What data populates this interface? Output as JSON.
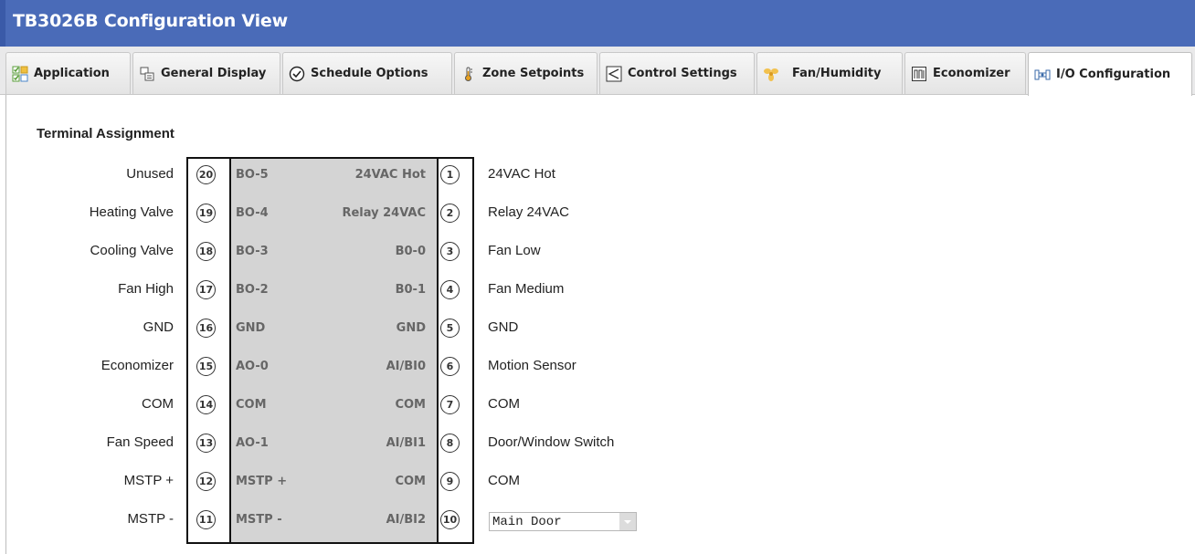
{
  "window": {
    "title": "TB3026B Configuration View"
  },
  "tabs": [
    {
      "label": "Application",
      "icon": "app-blocks-icon"
    },
    {
      "label": "General Display",
      "icon": "display-icon"
    },
    {
      "label": "Schedule Options",
      "icon": "clock-check-icon"
    },
    {
      "label": "Zone Setpoints",
      "icon": "thermometer-icon"
    },
    {
      "label": "Control Settings",
      "icon": "control-triangle-icon"
    },
    {
      "label": "Fan/Humidity",
      "icon": "fan-icon"
    },
    {
      "label": "Economizer",
      "icon": "economizer-icon"
    },
    {
      "label": "I/O Configuration",
      "icon": "io-config-icon",
      "active": true
    }
  ],
  "terminal": {
    "section_title": "Terminal Assignment",
    "rows": [
      {
        "left_label": "Unused",
        "left_pin": "20",
        "left_io": "BO-5",
        "right_io": "24VAC Hot",
        "right_pin": "1",
        "right_label": "24VAC Hot"
      },
      {
        "left_label": "Heating Valve",
        "left_pin": "19",
        "left_io": "BO-4",
        "right_io": "Relay 24VAC",
        "right_pin": "2",
        "right_label": "Relay 24VAC"
      },
      {
        "left_label": "Cooling Valve",
        "left_pin": "18",
        "left_io": "BO-3",
        "right_io": "B0-0",
        "right_pin": "3",
        "right_label": "Fan Low"
      },
      {
        "left_label": "Fan High",
        "left_pin": "17",
        "left_io": "BO-2",
        "right_io": "B0-1",
        "right_pin": "4",
        "right_label": "Fan Medium"
      },
      {
        "left_label": "GND",
        "left_pin": "16",
        "left_io": "GND",
        "right_io": "GND",
        "right_pin": "5",
        "right_label": "GND"
      },
      {
        "left_label": "Economizer",
        "left_pin": "15",
        "left_io": "AO-0",
        "right_io": "AI/BI0",
        "right_pin": "6",
        "right_label": "Motion Sensor"
      },
      {
        "left_label": "COM",
        "left_pin": "14",
        "left_io": "COM",
        "right_io": "COM",
        "right_pin": "7",
        "right_label": "COM"
      },
      {
        "left_label": "Fan Speed",
        "left_pin": "13",
        "left_io": "AO-1",
        "right_io": "AI/BI1",
        "right_pin": "8",
        "right_label": "Door/Window Switch"
      },
      {
        "left_label": "MSTP +",
        "left_pin": "12",
        "left_io": "MSTP +",
        "right_io": "COM",
        "right_pin": "9",
        "right_label": "COM"
      },
      {
        "left_label": "MSTP -",
        "left_pin": "11",
        "left_io": "MSTP -",
        "right_io": "AI/BI2",
        "right_pin": "10",
        "right_label": ""
      }
    ],
    "pin10_select": {
      "value": "Main Door"
    }
  }
}
